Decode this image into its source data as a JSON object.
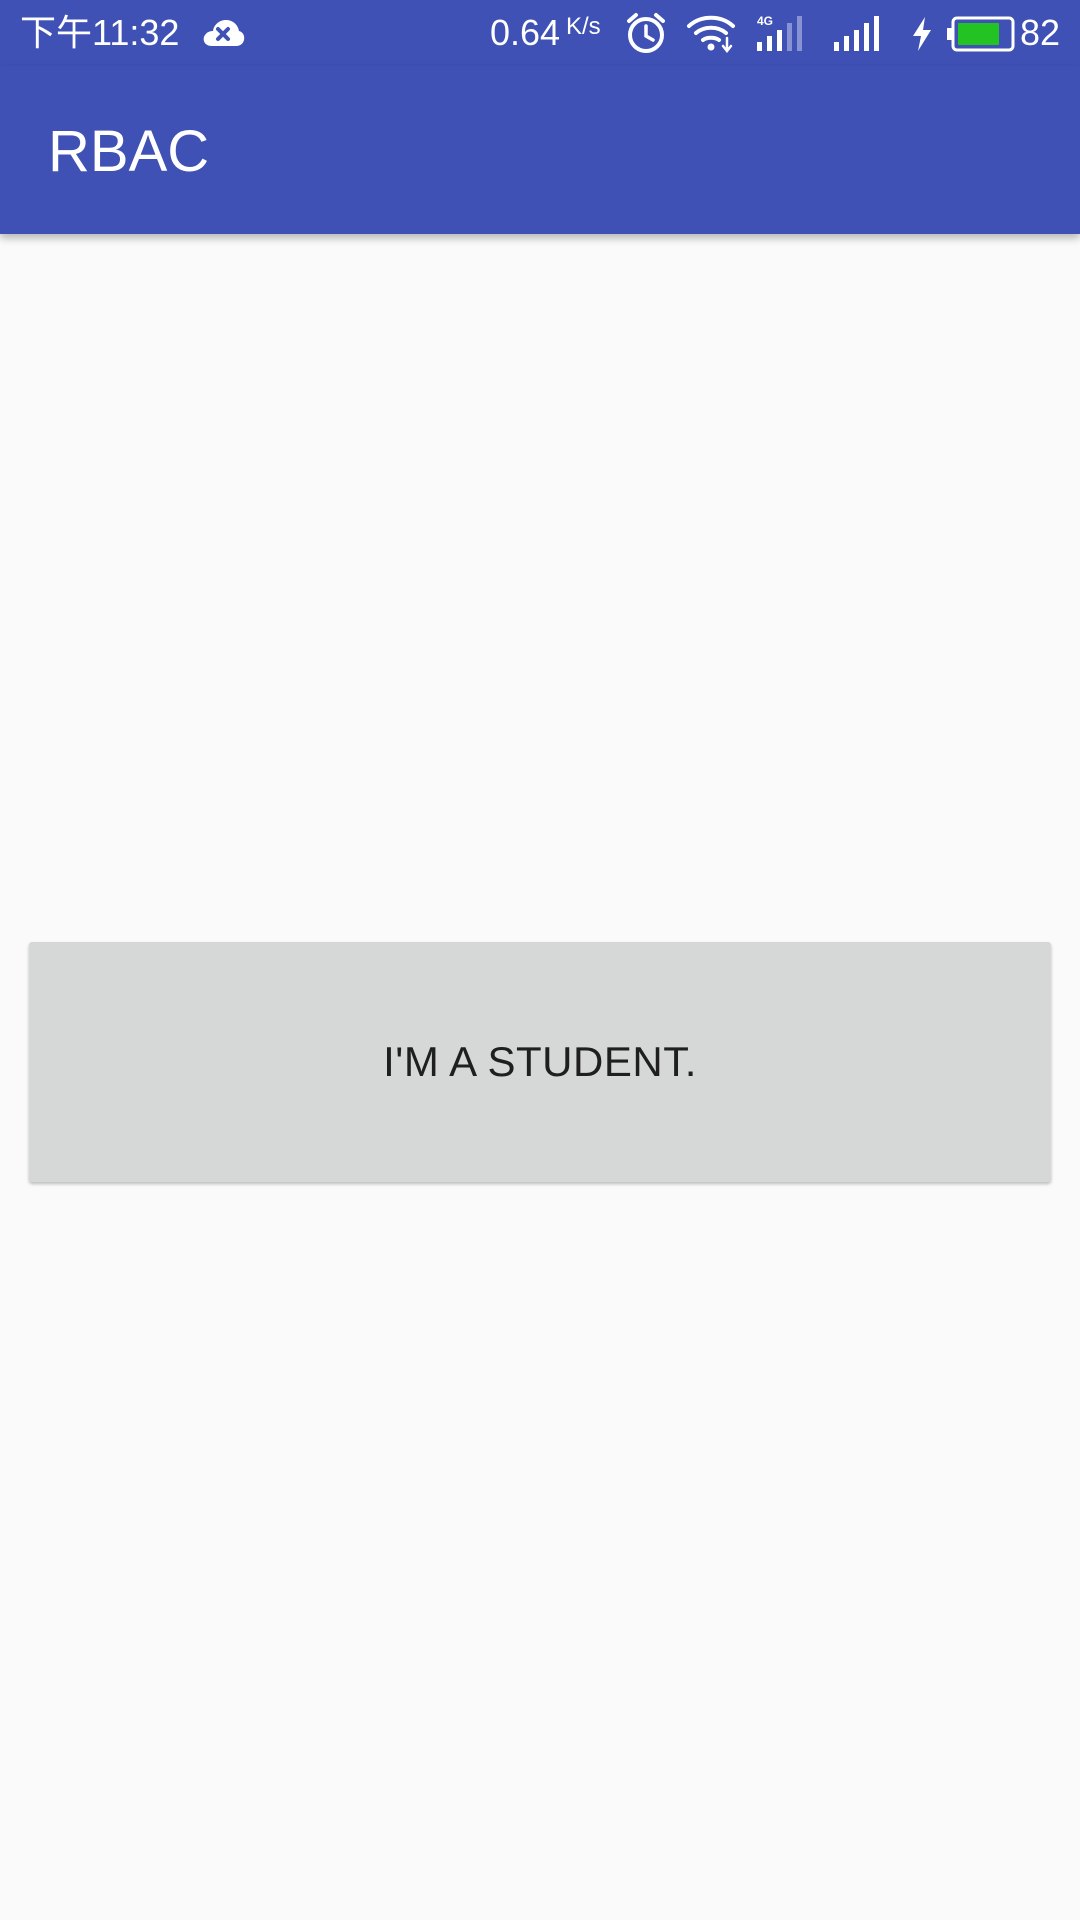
{
  "status_bar": {
    "time": "下午11:32",
    "network_speed": "0.64",
    "network_speed_unit": "K/s",
    "network_type": "4G",
    "battery_level": "82",
    "icons": [
      "cloud-off-icon",
      "alarm-icon",
      "wifi-icon",
      "signal-4g-icon",
      "signal-icon",
      "charging-icon",
      "battery-icon"
    ],
    "battery_color": "#22c322"
  },
  "app_bar": {
    "title": "RBAC",
    "color": "#3f51b5"
  },
  "main": {
    "button_label": "I'M A STUDENT.",
    "button_color": "#d6d7d7"
  }
}
